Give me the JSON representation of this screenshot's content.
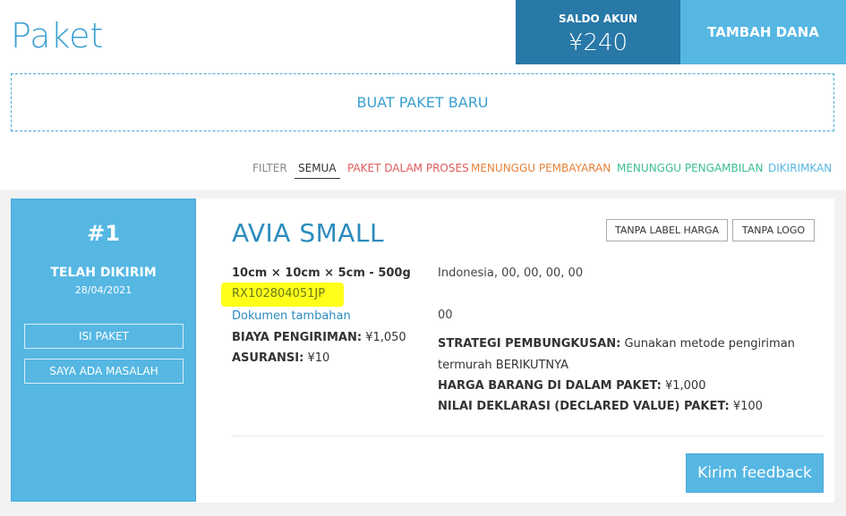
{
  "header": {
    "title": "Paket",
    "balance_label": "SALDO AKUN",
    "balance_value": "¥240",
    "topup_label": "TAMBAH DANA"
  },
  "new_package": {
    "label": "BUAT PAKET BARU"
  },
  "filter": {
    "label": "FILTER",
    "options": [
      "SEMUA",
      "PAKET DALAM PROSES",
      "MENUNGGU PEMBAYARAN",
      "MENUNGGU PENGAMBILAN",
      "DIKIRIMKAN"
    ],
    "selected": "SEMUA",
    "colors": {
      "process": "#e05a5a",
      "payment": "#e8823a",
      "pickup": "#3cbf8f",
      "sent": "#56b7e3"
    }
  },
  "package": {
    "number": "#1",
    "status": "TELAH DIKIRIM",
    "date": "28/04/2021",
    "btn_contents": "ISI PAKET",
    "btn_problem": "SAYA ADA MASALAH",
    "product": "AVIA SMALL",
    "tag_noprice": "TANPA LABEL HARGA",
    "tag_nologo": "TANPA LOGO",
    "dimensions": "10cm × 10cm × 5cm - 500g",
    "tracking": "RX102804051JP",
    "docs_link": "Dokumen tambahan",
    "ship_cost_label": "BIAYA PENGIRIMAN:",
    "ship_cost_value": "¥1,050",
    "insurance_label": "ASURANSI:",
    "insurance_value": "¥10",
    "address": "Indonesia, 00, 00, 00, 00",
    "code": "00",
    "strategy_label": "STRATEGI PEMBUNGKUSAN:",
    "strategy_value_1": "Gunakan metode pengiriman",
    "strategy_value_2": "termurah BERIKUTNYA",
    "goods_price_label": "HARGA BARANG DI DALAM PAKET:",
    "goods_price_value": "¥1,000",
    "declared_label": "NILAI DEKLARASI (DECLARED VALUE) PAKET:",
    "declared_value": "¥100",
    "feedback_label": "Kirim feedback"
  },
  "colors": {
    "accent": "#56b7e3",
    "dark_accent": "#2878a8",
    "highlight": "#ffff1a"
  }
}
